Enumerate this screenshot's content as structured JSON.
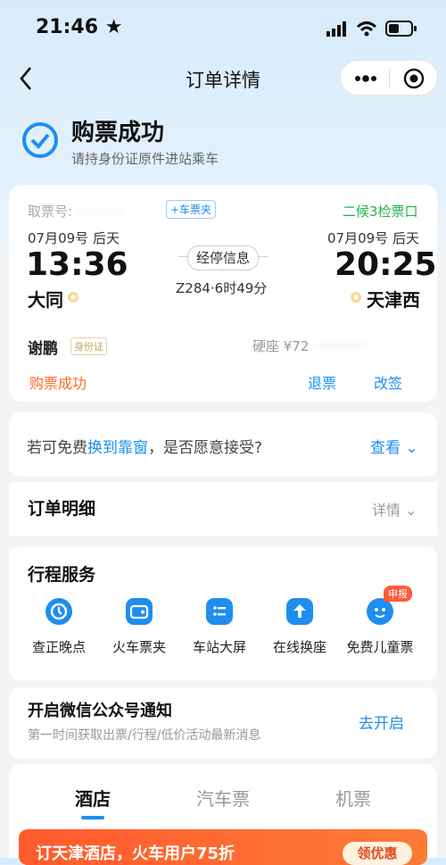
{
  "status_bar": {
    "time": "21:46"
  },
  "nav": {
    "title": "订单详情"
  },
  "header": {
    "title": "购票成功",
    "subtitle": "请持身份证原件进站乘车"
  },
  "ticket": {
    "pickup_label": "取票号:",
    "wallet_tag": "+车票夹",
    "gate": "二候3检票口",
    "depart_date": "07月09号 后天",
    "arrive_date": "07月09号 后天",
    "depart_time": "13:36",
    "arrive_time": "20:25",
    "depart_station": "大同",
    "arrive_station": "天津西",
    "stops_button": "经停信息",
    "train_info": "Z284·6时49分",
    "passenger": "谢鹏",
    "id_tag": "身份证",
    "seat": "硬座 ¥72",
    "status": "购票成功",
    "refund": "退票",
    "change": "改签"
  },
  "window_offer": {
    "pre": "若可免费",
    "link": "换到靠窗",
    "post": "，是否愿意接受?",
    "action": "查看"
  },
  "order_detail": {
    "title": "订单明细",
    "action": "详情"
  },
  "trip_services": {
    "title": "行程服务",
    "badge": "申报",
    "items": [
      {
        "label": "查正晚点",
        "icon": "clock-icon"
      },
      {
        "label": "火车票夹",
        "icon": "wallet-icon"
      },
      {
        "label": "车站大屏",
        "icon": "list-icon"
      },
      {
        "label": "在线换座",
        "icon": "seat-swap-icon"
      },
      {
        "label": "免费儿童票",
        "icon": "child-icon"
      }
    ]
  },
  "wechat": {
    "title": "开启微信公众号通知",
    "subtitle": "第一时间获取出票/行程/低价活动最新消息",
    "action": "去开启"
  },
  "tabs": [
    {
      "label": "酒店"
    },
    {
      "label": "汽车票"
    },
    {
      "label": "机票"
    }
  ],
  "banner": {
    "text": "订天津酒店，火车用户75折",
    "button": "领优惠"
  },
  "colors": {
    "blue": "#1e8ef0",
    "green": "#22b24c",
    "orange": "#ff6a2a"
  }
}
